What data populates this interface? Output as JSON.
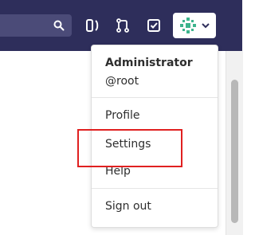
{
  "header": {
    "icons": [
      "search-icon",
      "merge-request-icon",
      "git-merge-icon",
      "todo-check-icon",
      "avatar-icon",
      "chevron-down-icon"
    ]
  },
  "user_menu": {
    "name": "Administrator",
    "username": "@root",
    "items": [
      {
        "label": "Profile"
      },
      {
        "label": "Settings"
      },
      {
        "label": "Help"
      },
      {
        "label": "Sign out"
      }
    ]
  },
  "colors": {
    "navbar": "#2e2e5b",
    "highlight": "#e02020"
  }
}
